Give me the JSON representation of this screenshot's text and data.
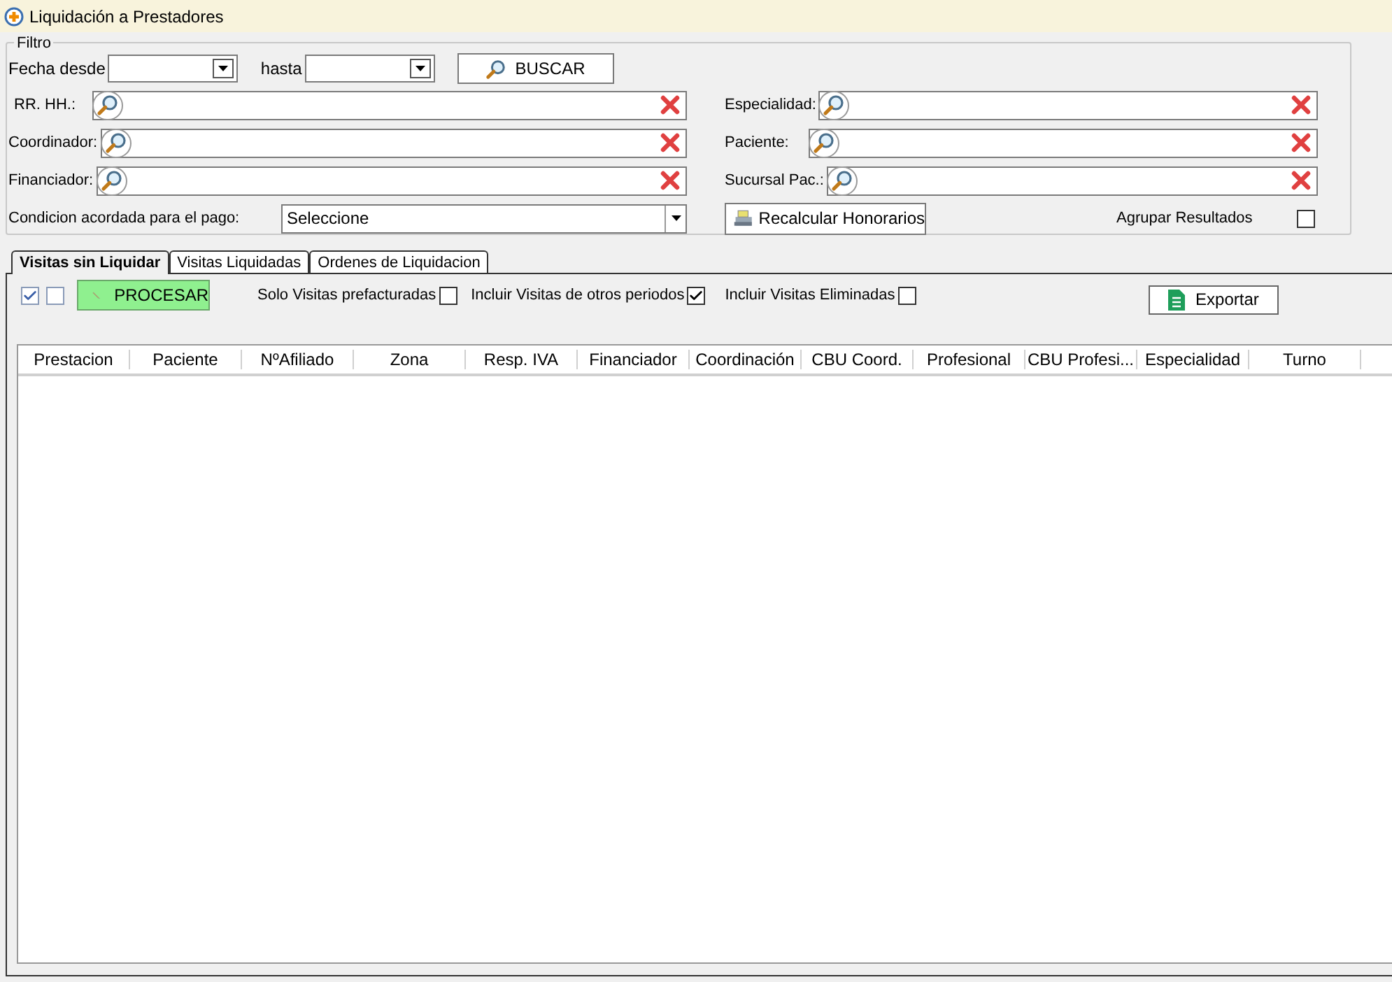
{
  "window": {
    "title": "Liquidación a Prestadores"
  },
  "filter": {
    "legend": "Filtro",
    "date_from": {
      "label": "Fecha desde"
    },
    "date_to": {
      "label": "hasta"
    },
    "search_button": "BUSCAR",
    "left_lookups": [
      {
        "label": "RR. HH.:"
      },
      {
        "label": "Coordinador:"
      },
      {
        "label": "Financiador:"
      }
    ],
    "right_lookups": [
      {
        "label": "Especialidad:"
      },
      {
        "label": "Paciente:"
      },
      {
        "label": "Sucursal Pac.:"
      }
    ],
    "condition": {
      "label": "Condicion acordada para el pago:",
      "value": "Seleccione"
    },
    "recalc_button": "Recalcular Honorarios",
    "group_results": {
      "label": "Agrupar Resultados",
      "checked": false
    }
  },
  "tabs": [
    {
      "label": "Visitas sin Liquidar",
      "selected": true
    },
    {
      "label": "Visitas Liquidadas",
      "selected": false
    },
    {
      "label": "Ordenes de Liquidacion",
      "selected": false
    }
  ],
  "toolbar": {
    "select_checks": [
      {
        "checked": true
      },
      {
        "checked": false
      }
    ],
    "process_button": "PROCESAR",
    "options": [
      {
        "label": "Solo Visitas prefacturadas",
        "checked": false
      },
      {
        "label": "Incluir Visitas de otros periodos",
        "checked": true
      },
      {
        "label": "Incluir Visitas Eliminadas",
        "checked": false
      }
    ],
    "export_button": "Exportar"
  },
  "table": {
    "columns": [
      "Prestacion",
      "Paciente",
      "NºAfiliado",
      "Zona",
      "Resp. IVA",
      "Financiador",
      "Coordinación",
      "CBU Coord.",
      "Profesional",
      "CBU Profesi...",
      "Especialidad",
      "Turno"
    ]
  }
}
